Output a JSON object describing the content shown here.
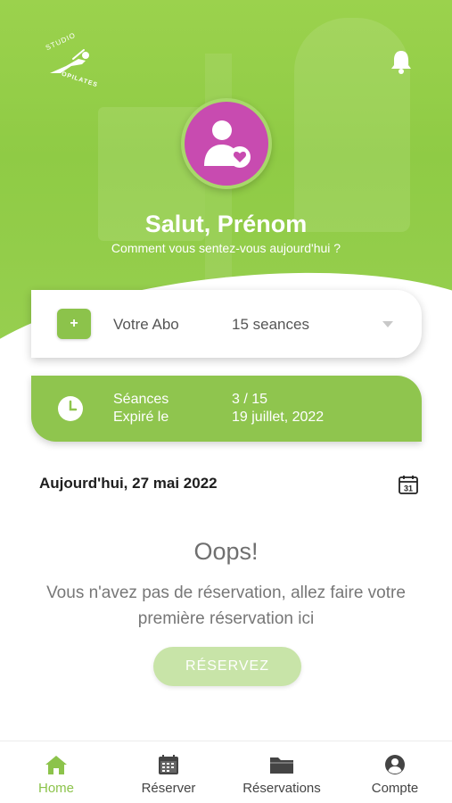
{
  "logo": {
    "studio_text": "STUDIO",
    "brand_text": "OPILATES"
  },
  "header": {
    "greeting": "Salut, Prénom",
    "subtitle": "Comment vous sentez-vous aujourd'hui ?"
  },
  "subscription": {
    "add_label": "+",
    "label": "Votre Abo",
    "value": "15 seances"
  },
  "sessions": {
    "sessions_label": "Séances",
    "sessions_value": "3 / 15",
    "expiry_label": "Expiré le",
    "expiry_value": "19 juillet, 2022"
  },
  "today": {
    "label": "Aujourd'hui, 27 mai 2022",
    "calendar_day": "31"
  },
  "empty_state": {
    "title": "Oops!",
    "message": "Vous n'avez pas de réservation, allez faire votre première réservation ici",
    "button": "RÉSERVEZ"
  },
  "nav": {
    "items": [
      {
        "label": "Home",
        "icon": "home-icon",
        "active": true
      },
      {
        "label": "Réserver",
        "icon": "calendar-icon",
        "active": false
      },
      {
        "label": "Réservations",
        "icon": "folder-icon",
        "active": false
      },
      {
        "label": "Compte",
        "icon": "account-icon",
        "active": false
      }
    ]
  },
  "colors": {
    "brand_green": "#8cc34b",
    "avatar_pink": "#c84bb0",
    "button_disabled": "#c8e4a8"
  }
}
